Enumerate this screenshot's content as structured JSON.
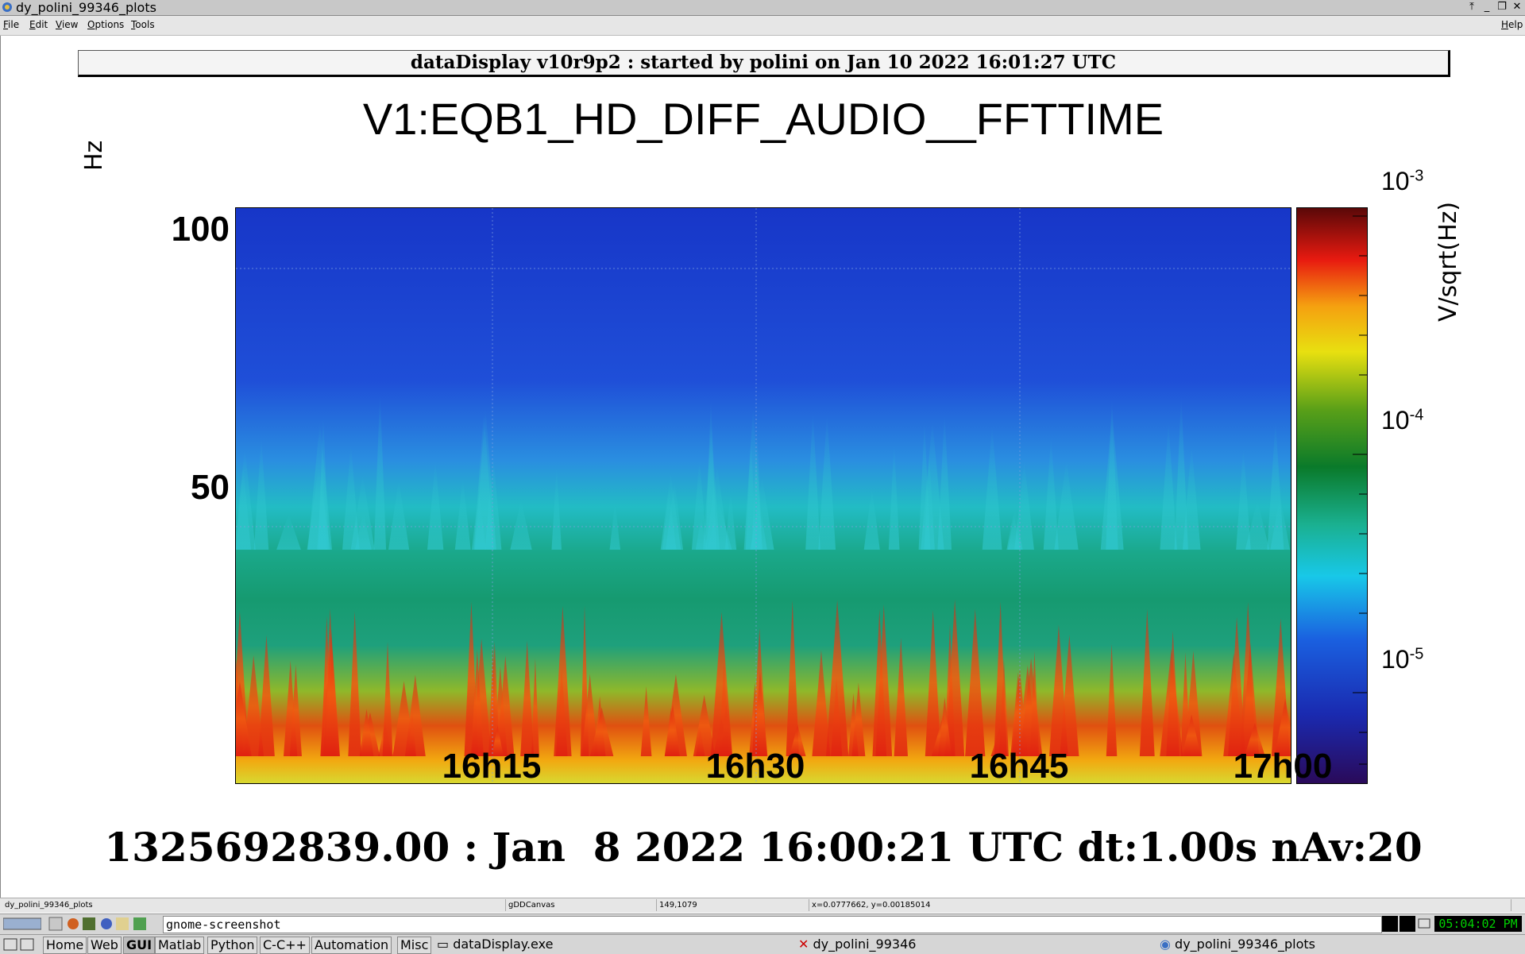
{
  "window": {
    "title": "dy_polini_99346_plots",
    "buttons": [
      "⤒",
      "_",
      "❐",
      "✕"
    ]
  },
  "menu": {
    "items": [
      "File",
      "Edit",
      "View",
      "Options",
      "Tools"
    ],
    "help": "Help"
  },
  "header": {
    "text": "dataDisplay v10r9p2 : started by polini on Jan 10 2022 16:01:27 UTC"
  },
  "plot": {
    "title": "V1:EQB1_HD_DIFF_AUDIO__FFTTIME",
    "y_label": "Hz",
    "y_ticks": [
      "100",
      "50"
    ],
    "x_ticks": [
      "16h15",
      "16h30",
      "16h45",
      "17h00"
    ],
    "colorbar_label": "V/sqrt(Hz)",
    "colorbar_ticks": [
      {
        "base": "10",
        "exp": "-3"
      },
      {
        "base": "10",
        "exp": "-4"
      },
      {
        "base": "10",
        "exp": "-5"
      }
    ],
    "footer": "1325692839.00 : Jan  8 2022 16:00:21 UTC dt:1.00s nAv:20"
  },
  "status": {
    "fields": [
      "dy_polini_99346_plots",
      "gDDCanvas",
      "149,1079",
      "x=0.0777662, y=0.00185014"
    ]
  },
  "taskbar": {
    "command": "gnome-screenshot",
    "clock": "05:04:02 PM",
    "launchers": [
      "Home",
      "Web",
      "GUI",
      "Matlab",
      "Python",
      "C-C++",
      "Automation",
      "Misc"
    ],
    "tasks": [
      "dataDisplay.exe",
      "dy_polini_99346",
      "dy_polini_99346_plots"
    ]
  },
  "chart_data": {
    "type": "heatmap",
    "title": "V1:EQB1_HD_DIFF_AUDIO__FFTTIME",
    "xlabel": "",
    "ylabel": "Hz",
    "x_ticks": [
      "16h15",
      "16h30",
      "16h45",
      "17h00"
    ],
    "x_range": [
      "16h00",
      "17h00"
    ],
    "y_ticks": [
      100,
      50
    ],
    "y_range": [
      0,
      112
    ],
    "colorbar": {
      "label": "V/sqrt(Hz)",
      "scale": "log",
      "range": [
        5e-06,
        0.001
      ],
      "ticks": [
        0.001,
        0.0001,
        1e-05
      ]
    },
    "colormap": "rainbow (dark purple → blue → cyan → green → yellow → red → dark red)",
    "grid": true
  }
}
